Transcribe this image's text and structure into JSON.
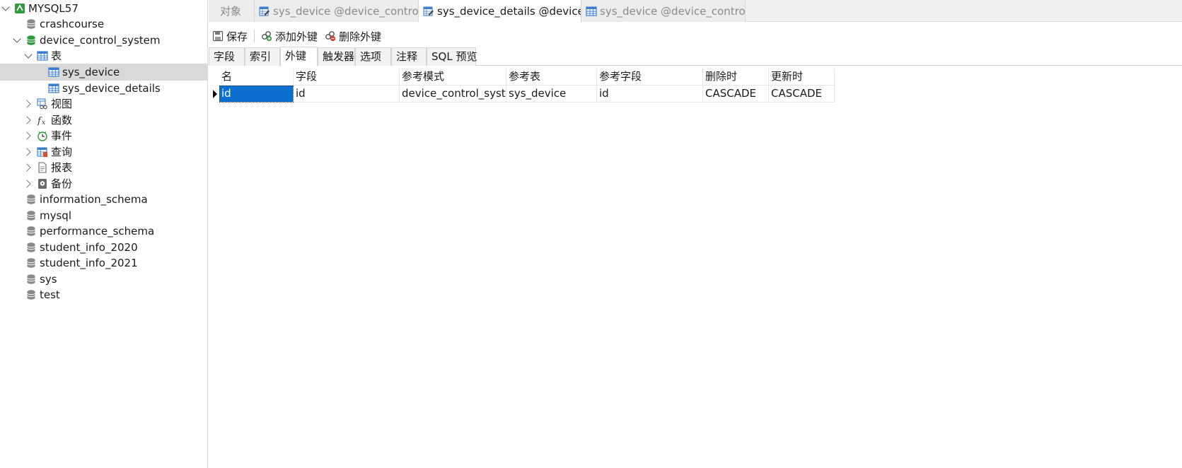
{
  "sidebar": {
    "items": [
      {
        "label": "MYSQL57",
        "icon": "connection-icon",
        "expanded": true
      },
      {
        "label": "crashcourse",
        "icon": "database-icon"
      },
      {
        "label": "device_control_system",
        "icon": "database-open-icon",
        "expanded": true
      },
      {
        "label": "表",
        "icon": "tables-folder-icon",
        "expanded": true
      },
      {
        "label": "sys_device",
        "icon": "table-icon",
        "selected": true
      },
      {
        "label": "sys_device_details",
        "icon": "table-icon"
      },
      {
        "label": "视图",
        "icon": "views-icon"
      },
      {
        "label": "函数",
        "icon": "function-icon"
      },
      {
        "label": "事件",
        "icon": "event-icon"
      },
      {
        "label": "查询",
        "icon": "query-icon"
      },
      {
        "label": "报表",
        "icon": "report-icon"
      },
      {
        "label": "备份",
        "icon": "backup-icon"
      },
      {
        "label": "information_schema",
        "icon": "database-icon"
      },
      {
        "label": "mysql",
        "icon": "database-icon"
      },
      {
        "label": "performance_schema",
        "icon": "database-icon"
      },
      {
        "label": "student_info_2020",
        "icon": "database-icon"
      },
      {
        "label": "student_info_2021",
        "icon": "database-icon"
      },
      {
        "label": "sys",
        "icon": "database-icon"
      },
      {
        "label": "test",
        "icon": "database-icon"
      }
    ]
  },
  "tabs": [
    {
      "label": "对象",
      "icon": ""
    },
    {
      "label": "sys_device @device_control...",
      "icon": "table-design-icon"
    },
    {
      "label": "sys_device_details @device...",
      "icon": "table-design-icon",
      "active": true
    },
    {
      "label": "sys_device @device_control...",
      "icon": "table-icon"
    }
  ],
  "toolbar": {
    "save_label": "保存",
    "add_fk_label": "添加外键",
    "delete_fk_label": "删除外键"
  },
  "subtabs": [
    "字段",
    "索引",
    "外键",
    "触发器",
    "选项",
    "注释",
    "SQL 预览"
  ],
  "active_subtab": "外键",
  "grid": {
    "columns": [
      "名",
      "字段",
      "参考模式",
      "参考表",
      "参考字段",
      "删除时",
      "更新时"
    ],
    "rows": [
      [
        "id",
        "id",
        "device_control_system",
        "sys_device",
        "id",
        "CASCADE",
        "CASCADE"
      ]
    ]
  },
  "colors": {
    "selection": "#0b6fd0",
    "sidebar_selected": "#d9d9d9",
    "database_icon": "#8a8a8a",
    "database_open_icon": "#2e9a3a",
    "connection_icon": "#2e9a3a"
  }
}
